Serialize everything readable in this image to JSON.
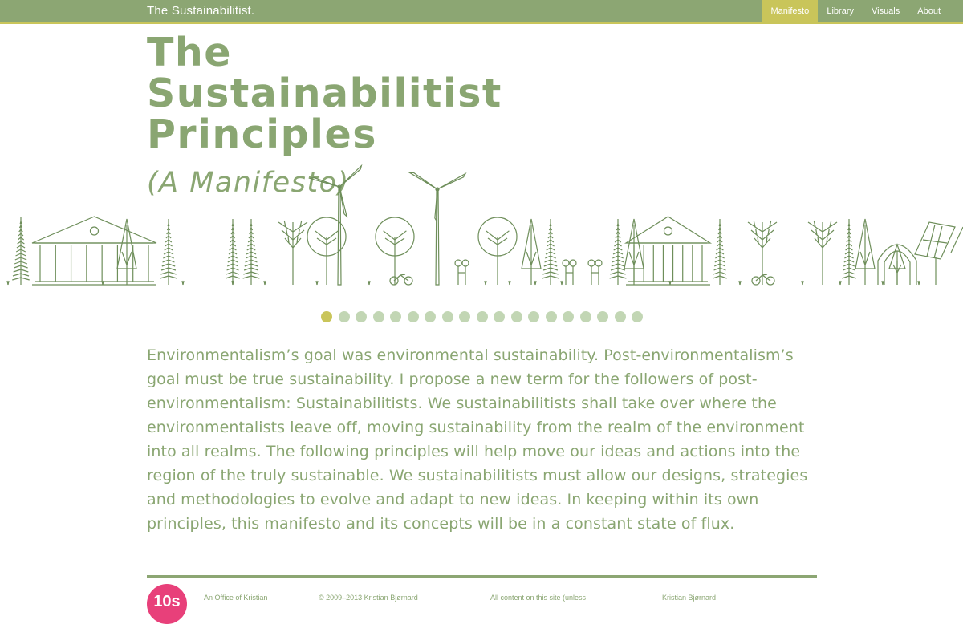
{
  "header": {
    "brand": "The Sustainabilitist.",
    "nav": [
      {
        "label": "Manifesto",
        "active": true
      },
      {
        "label": "Library",
        "active": false
      },
      {
        "label": "Visuals",
        "active": false
      },
      {
        "label": "About",
        "active": false
      }
    ]
  },
  "hero": {
    "title_lines": [
      "The",
      "Sustainabilitist",
      "Principles"
    ],
    "subtitle": "(A Manifesto)"
  },
  "carousel": {
    "total": 19,
    "active_index": 0
  },
  "intro": "Environmentalism’s goal was environmental sustainability. Post-environmentalism’s goal must be true sustainability. I propose a new term for the followers of post-environmentalism: Sustainabilitists. We sustainabilitists shall take over where the environmentalists leave off, moving sustainability from the realm of the environment into all realms. The following principles will help move our ideas and actions into the region of the truly sustainable. We sustainabilitists must allow our designs, strategies and methodologies to evolve and adapt to new ideas. In keeping within its own principles, this manifesto and its concepts will be in a constant state of flux.",
  "footer": {
    "logo_text": "10s",
    "cols": [
      "An  Office of Kristian",
      "© 2009–2013 Kristian Bjørnard",
      "All content on this site (unless",
      "Kristian Bjørnard"
    ]
  },
  "colors": {
    "green": "#8ca673",
    "accent": "#c9c55a",
    "dot": "#c2d6b4",
    "logo": "#e8407a"
  }
}
